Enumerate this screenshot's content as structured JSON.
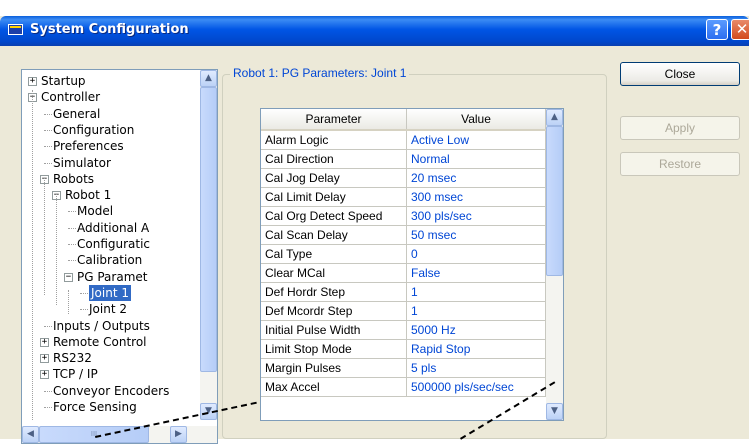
{
  "window": {
    "title": "System Configuration",
    "help_label": "?",
    "close_glyph": "✕"
  },
  "tree": {
    "nodes": [
      {
        "label": "Startup",
        "expander": "+"
      },
      {
        "label": "Controller",
        "expander": "−"
      },
      {
        "label": "General"
      },
      {
        "label": "Configuration"
      },
      {
        "label": "Preferences"
      },
      {
        "label": "Simulator"
      },
      {
        "label": "Robots",
        "expander": "−"
      },
      {
        "label": "Robot 1",
        "expander": "−"
      },
      {
        "label": "Model"
      },
      {
        "label": "Additional A"
      },
      {
        "label": "Configuratic"
      },
      {
        "label": "Calibration"
      },
      {
        "label": "PG Paramet",
        "expander": "−"
      },
      {
        "label": "Joint 1",
        "selected": true
      },
      {
        "label": "Joint 2"
      },
      {
        "label": "Inputs / Outputs"
      },
      {
        "label": "Remote Control",
        "expander": "+"
      },
      {
        "label": "RS232",
        "expander": "+"
      },
      {
        "label": "TCP / IP",
        "expander": "+"
      },
      {
        "label": "Conveyor Encoders"
      },
      {
        "label": "Force Sensing"
      }
    ],
    "hscroll_grip": "III"
  },
  "group_label": "Robot 1: PG Parameters: Joint 1",
  "grid": {
    "headers": [
      "Parameter",
      "Value"
    ],
    "rows": [
      [
        "Alarm Logic",
        "Active Low"
      ],
      [
        "Cal Direction",
        "Normal"
      ],
      [
        "Cal Jog Delay",
        "20 msec"
      ],
      [
        "Cal Limit Delay",
        "300 msec"
      ],
      [
        "Cal Org Detect Speed",
        "300 pls/sec"
      ],
      [
        "Cal Scan Delay",
        "50 msec"
      ],
      [
        "Cal Type",
        "0"
      ],
      [
        "Clear MCal",
        "False"
      ],
      [
        "Def Hordr Step",
        "1"
      ],
      [
        "Def Mcordr Step",
        "1"
      ],
      [
        "Initial Pulse Width",
        "5000 Hz"
      ],
      [
        "Limit Stop Mode",
        "Rapid Stop"
      ],
      [
        "Margin Pulses",
        "5 pls"
      ],
      [
        "Max Accel",
        "500000 pls/sec/sec"
      ]
    ]
  },
  "buttons": {
    "close": "Close",
    "apply": "Apply",
    "restore": "Restore"
  },
  "colors": {
    "accent": "#0046d5",
    "selection": "#316ac5",
    "titlebar": "#0055e5"
  }
}
